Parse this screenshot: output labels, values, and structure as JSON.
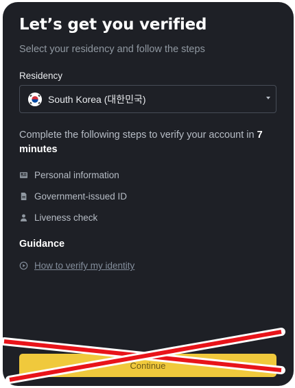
{
  "page": {
    "title": "Let’s get you verified",
    "subtitle": "Select your residency and follow the steps"
  },
  "residency": {
    "label": "Residency",
    "selected": "South Korea (대한민국)",
    "flag_icon": "south-korea-flag-icon"
  },
  "steps": {
    "intro_prefix": "Complete the following steps to verify your account in ",
    "duration": "7 minutes",
    "items": [
      {
        "label": "Personal information",
        "icon": "id-card-icon"
      },
      {
        "label": "Government-issued ID",
        "icon": "document-icon"
      },
      {
        "label": "Liveness check",
        "icon": "person-icon"
      }
    ]
  },
  "guidance": {
    "heading": "Guidance",
    "link": "How to verify my identity",
    "link_icon": "play-circle-icon"
  },
  "footer": {
    "continue_label": "Continue"
  },
  "colors": {
    "background": "#1e2026",
    "accent": "#f0c93c",
    "strike": "#e8141a"
  }
}
